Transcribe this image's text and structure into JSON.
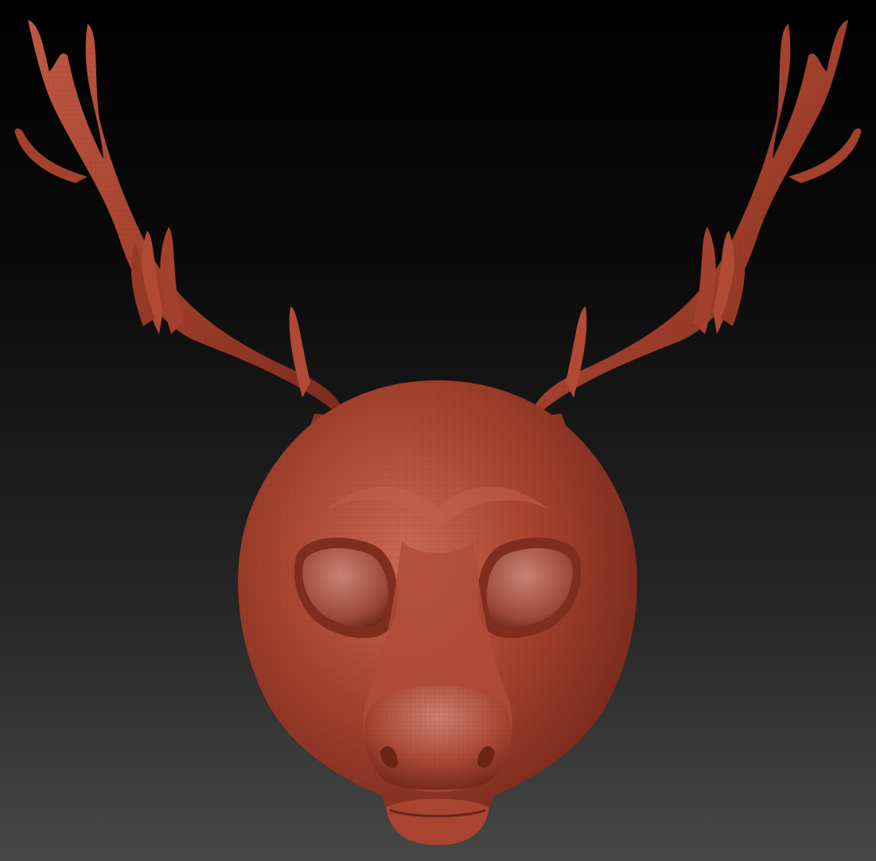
{
  "viewport": {
    "background_top": "#000000",
    "background_bottom": "#474747"
  },
  "model": {
    "subject": "deer-head-mask",
    "material_base": "#a3412c",
    "material_light": "#c8705e",
    "material_dark": "#5a1c12",
    "wireframe_color": "#6e2a1c",
    "wireframe_visible": true
  }
}
